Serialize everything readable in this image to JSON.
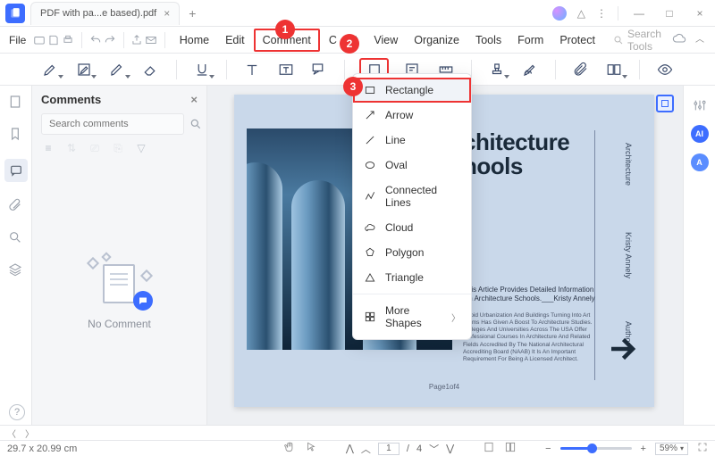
{
  "titlebar": {
    "tab_name": "PDF with pa...e based).pdf",
    "add_label": "+"
  },
  "menubar": {
    "file": "File",
    "tabs": [
      "Home",
      "Edit",
      "Comment",
      "C",
      "t",
      "View",
      "Organize",
      "Tools",
      "Form",
      "Protect"
    ],
    "active_index": 2,
    "search_placeholder": "Search Tools"
  },
  "comments": {
    "title": "Comments",
    "search_placeholder": "Search comments",
    "empty_label": "No Comment"
  },
  "shapes_menu": {
    "items": [
      "Rectangle",
      "Arrow",
      "Line",
      "Oval",
      "Connected Lines",
      "Cloud",
      "Polygon",
      "Triangle"
    ],
    "more": "More Shapes",
    "highlight_index": 0
  },
  "document": {
    "title_line1": "chitecture",
    "title_line2": "hools",
    "side_labels": [
      "Architecture",
      "Kristy Annely",
      "Author"
    ],
    "summary": "This Article Provides Detailed Information On Architecture Schools.___Kristy Annely",
    "subtext": "Rapid Urbanization And Buildings Turning Into Art Forms Has Given A Boost To Architecture Studies. Colleges And Universities Across The USA Offer Professional Courses In Architecture And Related Fields Accredited By The National Architectural Accrediting Board (NAAB) It Is An Important Requirement For Being A Licensed Architect.",
    "page_label": "Page1of4"
  },
  "footer": {
    "dimensions": "29.7 x 20.99 cm",
    "current_page": "1",
    "total_pages": "4",
    "zoom": "59%"
  },
  "callouts": {
    "c1": "1",
    "c2": "2",
    "c3": "3"
  },
  "rr": {
    "ai1": "AI",
    "ai2": "A"
  }
}
